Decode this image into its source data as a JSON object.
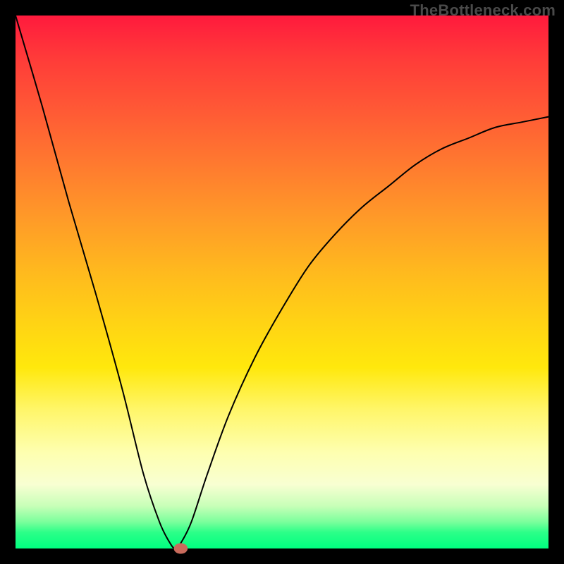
{
  "watermark": "TheBottleneck.com",
  "chart_data": {
    "type": "line",
    "title": "",
    "xlabel": "",
    "ylabel": "",
    "xlim": [
      0,
      100
    ],
    "ylim": [
      0,
      100
    ],
    "legend_position": "none",
    "grid": false,
    "series": [
      {
        "name": "curve",
        "x": [
          0,
          5,
          10,
          15,
          20,
          24,
          27,
          29,
          30,
          31,
          33,
          36,
          40,
          45,
          50,
          55,
          60,
          65,
          70,
          75,
          80,
          85,
          90,
          95,
          100
        ],
        "values": [
          100,
          83,
          65,
          48,
          30,
          14,
          5,
          1,
          0,
          1,
          5,
          14,
          25,
          36,
          45,
          53,
          59,
          64,
          68,
          72,
          75,
          77,
          79,
          80,
          81
        ]
      }
    ],
    "marker": {
      "x": 31,
      "y": 0,
      "color": "#c96b5c"
    },
    "gradient_colors": {
      "top": "#ff1a3d",
      "mid_high": "#ff9a28",
      "mid": "#ffe80c",
      "mid_low": "#feffb0",
      "bottom": "#00ff80"
    }
  }
}
